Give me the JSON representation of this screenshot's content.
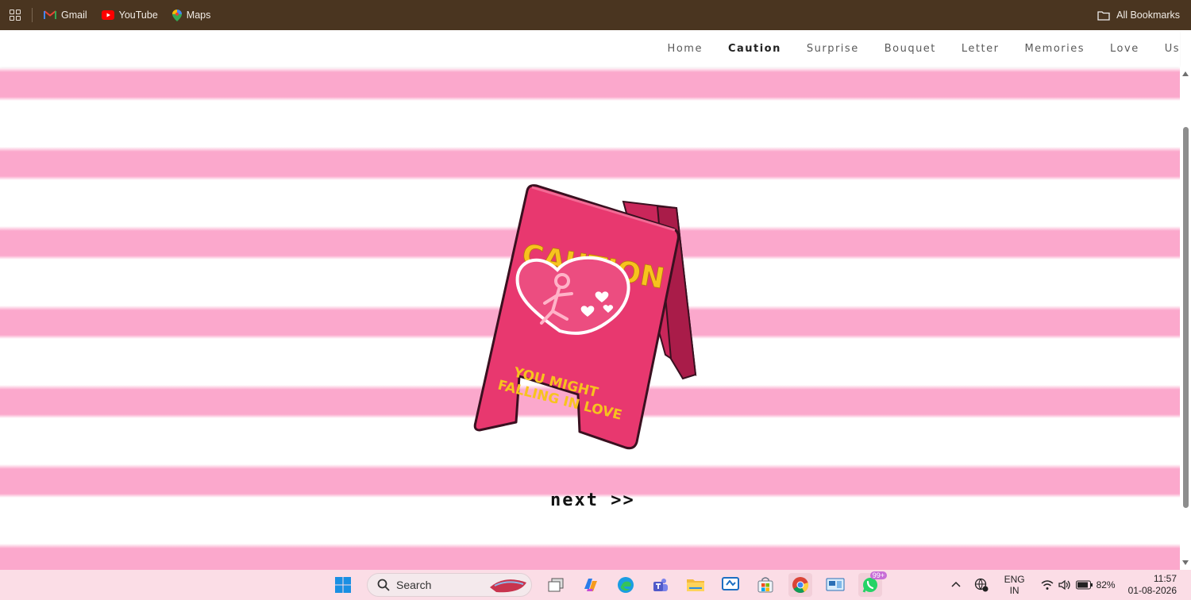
{
  "browser": {
    "bookmarks": [
      {
        "label": "Gmail",
        "icon": "gmail-icon"
      },
      {
        "label": "YouTube",
        "icon": "youtube-icon"
      },
      {
        "label": "Maps",
        "icon": "maps-icon"
      }
    ],
    "all_bookmarks_label": "All Bookmarks"
  },
  "site_nav": {
    "items": [
      "Home",
      "Caution",
      "Surprise",
      "Bouquet",
      "Letter",
      "Memories",
      "Love",
      "Us"
    ],
    "active": "Caution"
  },
  "sign": {
    "heading": "CAUTION",
    "line1": "YOU MIGHT",
    "line2": "FALLING IN LOVE"
  },
  "next_label": "next >>",
  "taskbar": {
    "search_label": "Search",
    "whatsapp_badge": "99+",
    "lang_line1": "ENG",
    "lang_line2": "IN",
    "battery": "82%",
    "time": "11:57",
    "date": "01-08-2026"
  },
  "colors": {
    "stripe_pink": "#fba8cc",
    "sign_pink": "#e8386f",
    "sign_text_yellow": "#f7c31e",
    "bookmark_bar": "#4a3520"
  }
}
